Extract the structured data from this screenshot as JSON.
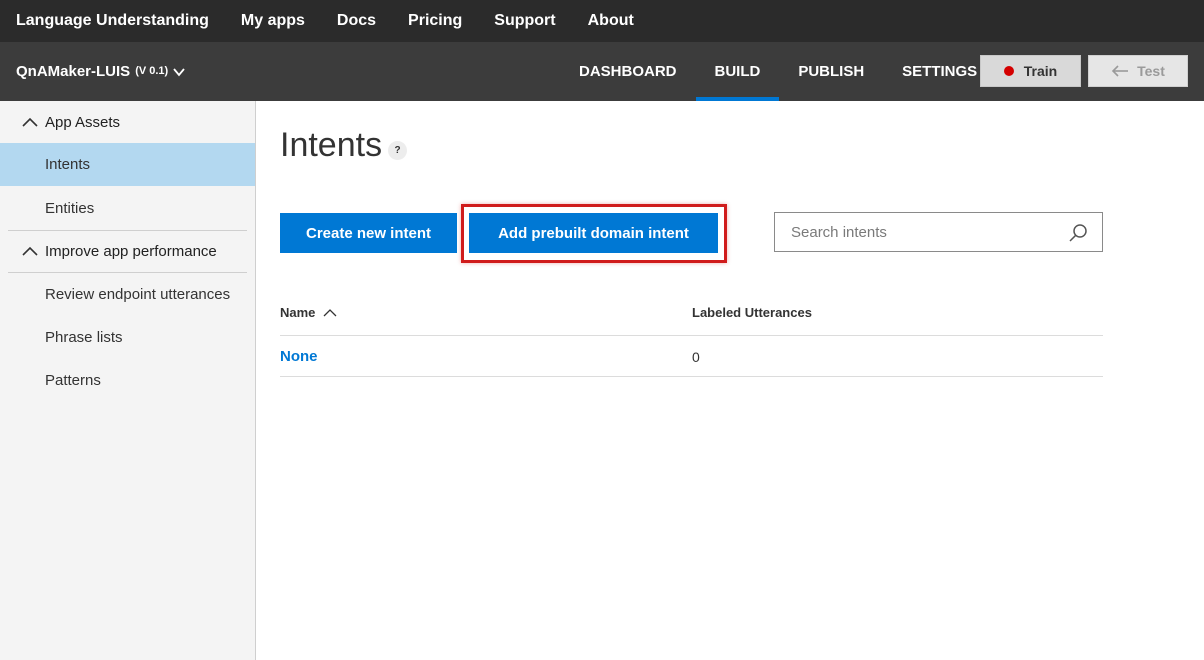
{
  "topnav": {
    "items": [
      "Language Understanding",
      "My apps",
      "Docs",
      "Pricing",
      "Support",
      "About"
    ]
  },
  "appbar": {
    "app_name": "QnAMaker-LUIS",
    "version": "(V 0.1)",
    "tabs": [
      "DASHBOARD",
      "BUILD",
      "PUBLISH",
      "SETTINGS"
    ],
    "active_tab": "BUILD",
    "train_label": "Train",
    "test_label": "Test"
  },
  "sidebar": {
    "sections": [
      "App Assets",
      "Improve app performance"
    ],
    "app_assets_items": [
      "Intents",
      "Entities"
    ],
    "improve_items": [
      "Review endpoint utterances",
      "Phrase lists",
      "Patterns"
    ],
    "active_item": "Intents"
  },
  "main": {
    "title": "Intents",
    "help": "?",
    "create_label": "Create new intent",
    "add_prebuilt_label": "Add prebuilt domain intent",
    "search_placeholder": "Search intents",
    "table": {
      "columns": [
        "Name",
        "Labeled Utterances"
      ],
      "rows": [
        {
          "name": "None",
          "utterances": "0"
        }
      ]
    }
  },
  "colors": {
    "accent": "#0078d4",
    "topnav_bg": "#2b2b2b",
    "appbar_bg": "#3c3c3c",
    "active_sidebar": "#b3d8f0",
    "highlight_border": "#d01c1c",
    "train_dot": "#d40000"
  }
}
